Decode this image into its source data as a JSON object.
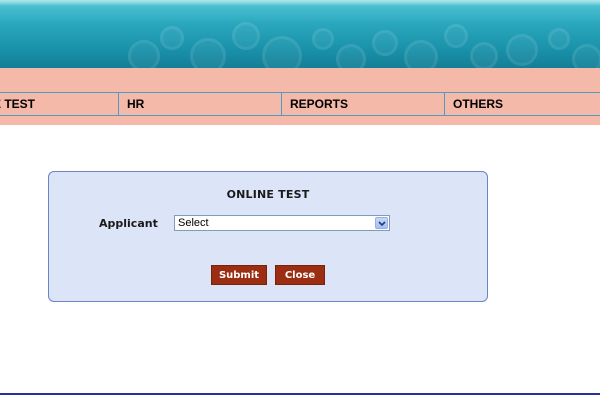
{
  "nav": {
    "items": [
      {
        "label": "E TEST"
      },
      {
        "label": "HR"
      },
      {
        "label": "REPORTS"
      },
      {
        "label": "OTHERS"
      }
    ]
  },
  "form": {
    "title": "ONLINE TEST",
    "applicant_label": "Applicant",
    "applicant_select": {
      "value": "Select",
      "icon": "chevron-down-icon"
    },
    "submit_label": "Submit",
    "close_label": "Close"
  },
  "colors": {
    "banner_teal": "#2aa7bd",
    "nav_pink": "#f4b9a8",
    "panel_bg": "#dce4f8",
    "button_maroon": "#9b2e12",
    "bottom_rule": "#2b2f9e"
  }
}
